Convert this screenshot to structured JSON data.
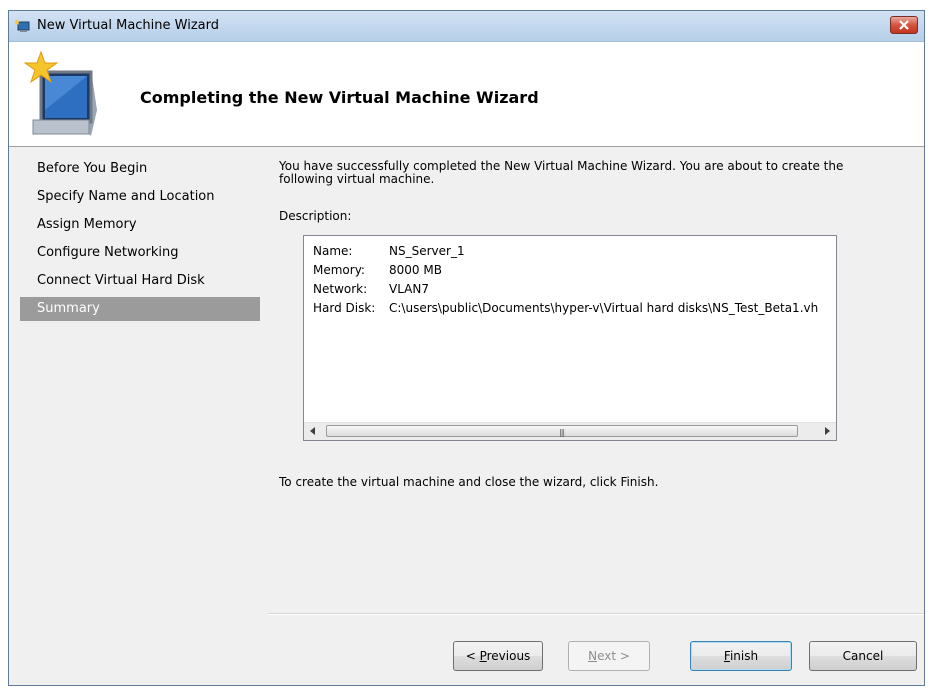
{
  "window": {
    "title": "New Virtual Machine Wizard",
    "header_title": "Completing the New Virtual Machine Wizard"
  },
  "nav": {
    "items": [
      {
        "label": "Before You Begin",
        "active": false
      },
      {
        "label": "Specify Name and Location",
        "active": false
      },
      {
        "label": "Assign Memory",
        "active": false
      },
      {
        "label": "Configure Networking",
        "active": false
      },
      {
        "label": "Connect Virtual Hard Disk",
        "active": false
      },
      {
        "label": "Summary",
        "active": true
      }
    ]
  },
  "content": {
    "intro": "You have successfully completed the New Virtual Machine Wizard. You are about to create the following virtual machine.",
    "description_label": "Description:",
    "description": [
      {
        "key": "Name:",
        "value": "NS_Server_1"
      },
      {
        "key": "Memory:",
        "value": "8000 MB"
      },
      {
        "key": "Network:",
        "value": "VLAN7"
      },
      {
        "key": "Hard Disk:",
        "value": "C:\\users\\public\\Documents\\hyper-v\\Virtual hard disks\\NS_Test_Beta1.vh"
      }
    ],
    "finish_hint": "To create the virtual machine and close the wizard, click Finish."
  },
  "buttons": {
    "previous": {
      "mnemonic": "P",
      "rest": "revious"
    },
    "next": {
      "mnemonic": "N",
      "rest": "ext >"
    },
    "finish": {
      "mnemonic": "F",
      "rest": "inish"
    },
    "cancel": "Cancel"
  },
  "colors": {
    "active_nav_bg": "#9b9b9b",
    "close_button": "#c2351f",
    "default_button_border": "#3c7fb1"
  },
  "icons": {
    "title": "hyperv-vm-icon",
    "header": "monitor-star-icon",
    "close": "close-icon",
    "scroll_left": "arrow-left-icon",
    "scroll_right": "arrow-right-icon"
  }
}
